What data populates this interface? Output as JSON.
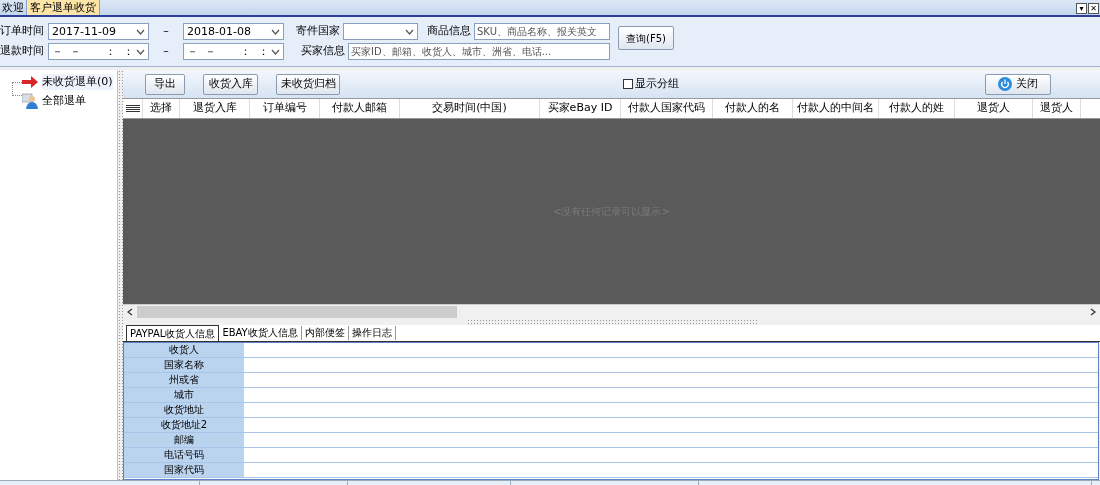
{
  "tabs": [
    {
      "label": "欢迎",
      "selected": false
    },
    {
      "label": "客户退单收货",
      "selected": true
    }
  ],
  "window_buttons": [
    "▾",
    "✕"
  ],
  "filters": {
    "order_time": {
      "label": "订单时间",
      "from": "2017-11-09",
      "dash": "–",
      "to": "2018-01-08"
    },
    "refund_time": {
      "label": "退款时间",
      "from": "－  －       ：  ：",
      "dash": "–",
      "to": "－  －       ：  ："
    },
    "country": {
      "label": "寄件国家"
    },
    "product": {
      "label": "商品信息",
      "placeholder": "SKU、商品名称、报关英文"
    },
    "buyer": {
      "label": "买家信息",
      "placeholder": "买家ID、邮箱、收货人、城市、洲省、电话..."
    },
    "query_button": "查询(F5)"
  },
  "tree": [
    {
      "label": "未收货退单(0)",
      "kind": "arrow",
      "selected": true
    },
    {
      "label": "全部退单",
      "kind": "user",
      "selected": false
    }
  ],
  "toolbar": {
    "buttons": [
      "导出",
      "收货入库",
      "未收货归档"
    ],
    "group_checkbox": {
      "label": "显示分组",
      "checked": false
    },
    "close_button": "关闭"
  },
  "table": {
    "columns": [
      "选择",
      "退货入库",
      "订单编号",
      "付款人邮箱",
      "交易时间(中国)",
      "买家eBay ID",
      "付款人国家代码",
      "付款人的名",
      "付款人的中间名",
      "付款人的姓",
      "退货人",
      "退货人"
    ],
    "empty_text": "<没有任何记录可以显示>"
  },
  "detail_tabs": [
    {
      "label": "PAYPAL收货人信息",
      "selected": true
    },
    {
      "label": "EBAY收货人信息",
      "selected": false
    },
    {
      "label": "内部便签",
      "selected": false
    },
    {
      "label": "操作日志",
      "selected": false
    }
  ],
  "detail_fields": [
    "收货人",
    "国家名称",
    "州或省",
    "城市",
    "收货地址",
    "收货地址2",
    "邮编",
    "电话号码",
    "国家代码"
  ]
}
